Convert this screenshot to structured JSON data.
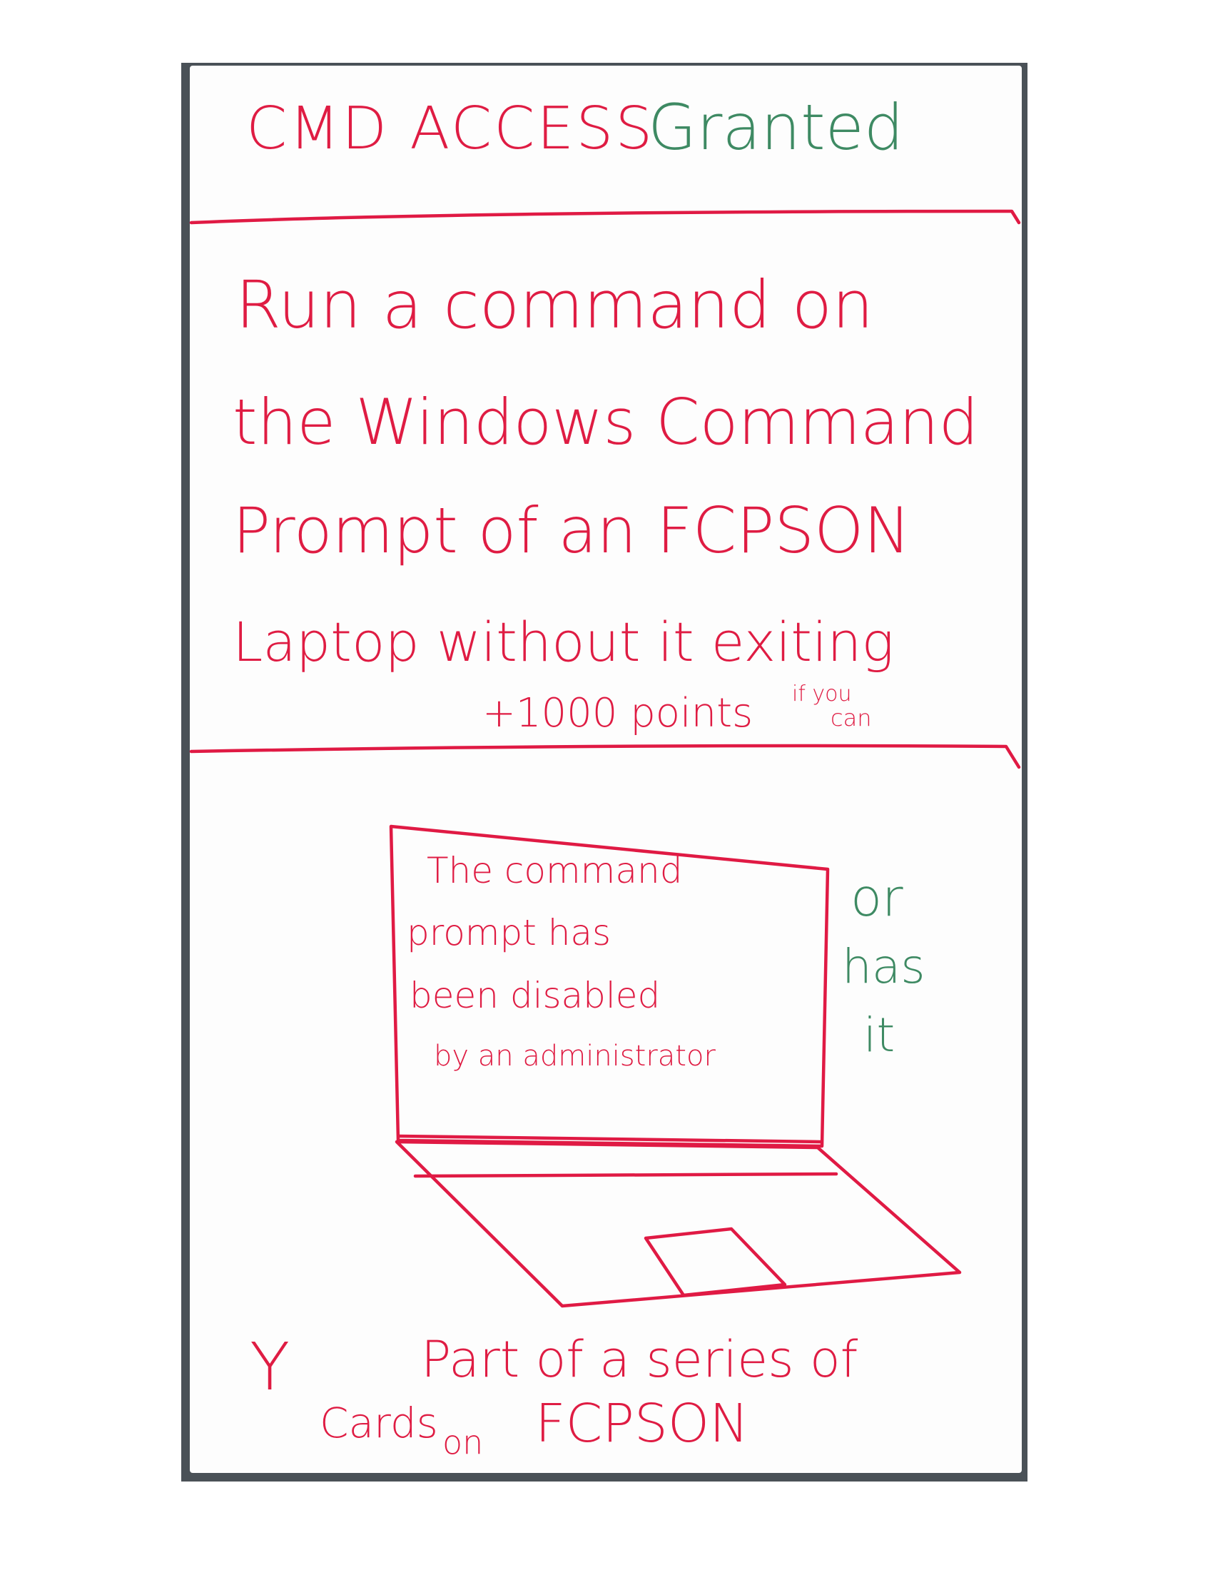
{
  "card": {
    "title_red": "CMD ACCESS",
    "title_green": "Granted",
    "body": {
      "line1": "Run a command on",
      "line2": "the Windows Command",
      "line3": "Prompt of an FCPSON",
      "line4": "Laptop without it exiting",
      "bonus": "+1000 points",
      "bonus_if": "if you",
      "bonus_can": "can"
    },
    "screen": {
      "line1": "The command",
      "line2": "prompt has",
      "line3": "been disabled",
      "line4": "by an administrator"
    },
    "aside": {
      "line1": "or",
      "line2": "has",
      "line3": "it"
    },
    "footer": {
      "symbol": "Y",
      "line1": "Part of a series of",
      "line2_a": "Cards",
      "line2_b": "on",
      "line2_c": "FCPSON"
    },
    "colors": {
      "ink_red": "#df1c43",
      "ink_green": "#3e8a63",
      "card_edge": "#4a5157"
    }
  }
}
